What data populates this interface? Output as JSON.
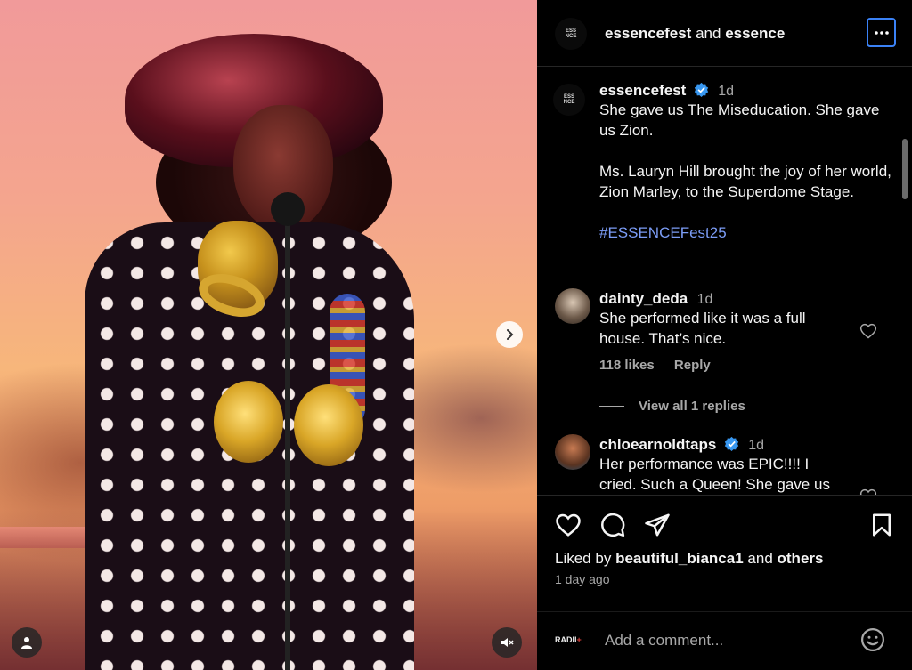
{
  "post": {
    "nav_next_label": "Next",
    "tag_button_label": "Tags",
    "mute_button_label": "Audio muted"
  },
  "header": {
    "author1": "essencefest",
    "joiner": "and",
    "author2": "essence",
    "more_label": "More options"
  },
  "caption": {
    "username": "essencefest",
    "time": "1d",
    "line1": "She gave us The Miseducation. She gave us Zion.",
    "line2": "Ms. Lauryn Hill brought the joy of her world, Zion Marley, to the Superdome Stage.",
    "hashtag": "#ESSENCEFest25"
  },
  "comments": [
    {
      "username": "dainty_deda",
      "time": "1d",
      "text": "She performed like it was a full house. That’s nice.",
      "likes": "118 likes",
      "reply": "Reply",
      "view_replies": "View all 1 replies"
    },
    {
      "username": "chloearnoldtaps",
      "time": "1d",
      "text": "Her performance was EPIC!!!! I cried. Such a Queen! She gave us"
    }
  ],
  "actions": {
    "liked_by_prefix": "Liked by",
    "liked_by_user": "beautiful_bianca1",
    "liked_by_joiner": "and",
    "liked_by_others": "others",
    "post_time": "1 day ago",
    "comment_placeholder": "Add a comment...",
    "brand_badge": "RADII",
    "brand_badge_plus": "+"
  },
  "icons": {
    "verified": "verified-badge-icon",
    "like": "heart-icon",
    "comment": "comment-icon",
    "share": "share-icon",
    "save": "bookmark-icon",
    "emoji": "emoji-icon",
    "more": "more-horizontal-icon",
    "next": "chevron-right-icon",
    "tag": "user-tag-icon",
    "mute": "speaker-muted-icon"
  },
  "colors": {
    "background": "#000000",
    "text": "#f5f5f5",
    "secondary_text": "#a8a8a8",
    "hashtag": "#7b9cf5",
    "verified": "#3897f0",
    "focus_ring": "#3b82f6"
  }
}
